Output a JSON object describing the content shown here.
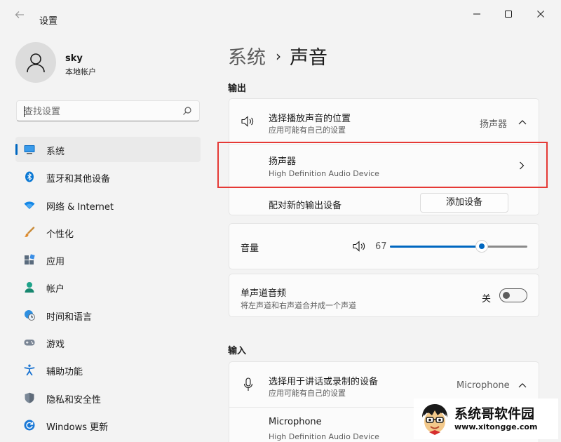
{
  "window": {
    "title": "设置",
    "back_icon": "arrow-left-icon",
    "controls": [
      "minimize-icon",
      "maximize-icon",
      "close-icon"
    ]
  },
  "user": {
    "name": "sky",
    "account_type": "本地帐户",
    "avatar_icon": "person-icon"
  },
  "search": {
    "placeholder": "查找设置",
    "value": ""
  },
  "sidebar": {
    "items": [
      {
        "label": "系统",
        "icon": "monitor-icon",
        "active": true
      },
      {
        "label": "蓝牙和其他设备",
        "icon": "bluetooth-icon"
      },
      {
        "label": "网络 & Internet",
        "icon": "wifi-icon"
      },
      {
        "label": "个性化",
        "icon": "brush-icon"
      },
      {
        "label": "应用",
        "icon": "apps-icon"
      },
      {
        "label": "帐户",
        "icon": "account-icon"
      },
      {
        "label": "时间和语言",
        "icon": "globe-clock-icon"
      },
      {
        "label": "游戏",
        "icon": "gamepad-icon"
      },
      {
        "label": "辅助功能",
        "icon": "accessibility-icon"
      },
      {
        "label": "隐私和安全性",
        "icon": "shield-icon"
      },
      {
        "label": "Windows 更新",
        "icon": "update-icon"
      }
    ]
  },
  "breadcrumb": {
    "parent": "系统",
    "separator": "›",
    "current": "声音"
  },
  "output": {
    "section_title": "输出",
    "choose_title": "选择播放声音的位置",
    "choose_sub": "应用可能有自己的设置",
    "choose_value": "扬声器",
    "device_name": "扬声器",
    "device_desc": "High Definition Audio Device",
    "pair_label": "配对新的输出设备",
    "add_device_button": "添加设备"
  },
  "volume": {
    "label": "音量",
    "value": "67",
    "level": 0.67
  },
  "mono": {
    "title": "单声道音频",
    "sub": "将左声道和右声道合并成一个声道",
    "state_label": "关"
  },
  "input": {
    "section_title": "输入",
    "choose_title": "选择用于讲话或录制的设备",
    "choose_sub": "应用可能有自己的设置",
    "choose_value": "Microphone",
    "device_name": "Microphone",
    "device_desc": "High Definition Audio Device"
  },
  "watermark": {
    "name": "系统哥软件园",
    "url": "www.xitongge.com"
  },
  "colors": {
    "accent": "#0067c0",
    "highlight": "#e53935",
    "background": "#f3f3f3",
    "card": "#fbfbfb"
  }
}
